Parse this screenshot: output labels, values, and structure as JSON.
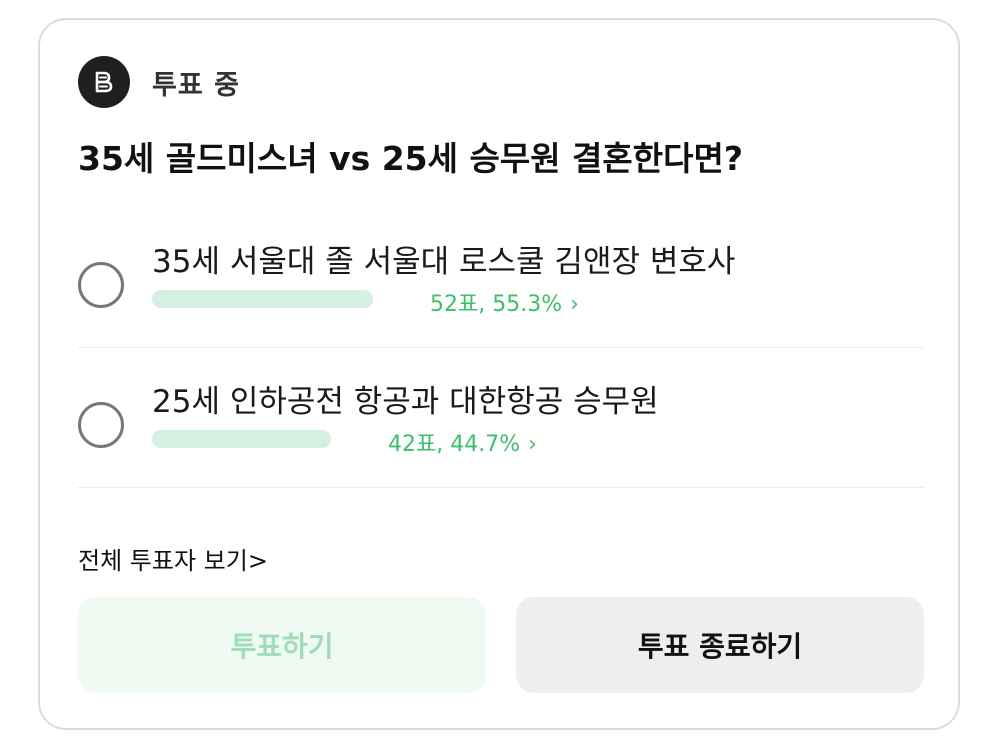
{
  "status": {
    "label": "투표 중",
    "icon": "poll-icon"
  },
  "question": "35세 골드미스녀 vs 25세 승무원 결혼한다면?",
  "options": [
    {
      "label": "35세 서울대 졸 서울대 로스쿨 김앤장 변호사",
      "result": "52표, 55.3%",
      "percent": 55.3
    },
    {
      "label": "25세 인하공전 항공과 대한항공 승무원",
      "result": "42표, 44.7%",
      "percent": 44.7
    }
  ],
  "chevron": "›",
  "voters_link": "전체 투표자 보기>",
  "buttons": {
    "vote": "투표하기",
    "end": "투표 종료하기"
  },
  "colors": {
    "accent_green": "#3cc06a",
    "bar_fill": "#d5efe0",
    "vote_button_bg": "#eefaf2",
    "vote_button_text": "#9fddb7",
    "end_button_bg": "#eeeeee"
  }
}
